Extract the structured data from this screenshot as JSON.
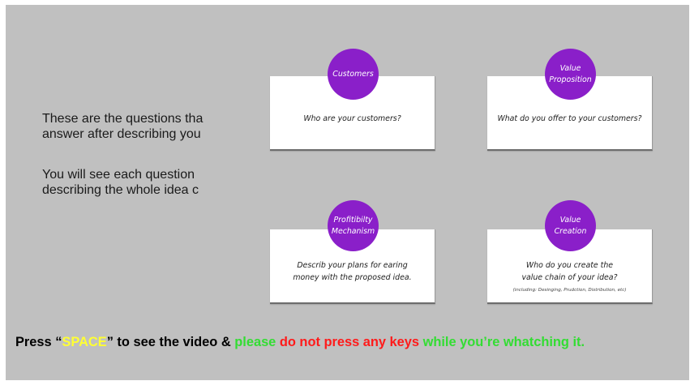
{
  "intro": {
    "paragraph1": [
      "These are the questions tha",
      "answer after describing you"
    ],
    "paragraph2": [
      "You will see each question",
      "describing the whole idea c"
    ]
  },
  "cards": [
    {
      "title_lines": [
        "Customers"
      ],
      "question_lines": [
        "Who are your customers?"
      ],
      "note": ""
    },
    {
      "title_lines": [
        "Value",
        "Proposition"
      ],
      "question_lines": [
        "What do you offer to your customers?"
      ],
      "note": ""
    },
    {
      "title_lines": [
        "Profitibilty",
        "Mechanism"
      ],
      "question_lines": [
        "Describ your plans for earing",
        "money with the proposed idea."
      ],
      "note": ""
    },
    {
      "title_lines": [
        "Value",
        "Creation"
      ],
      "question_lines": [
        "Who do you create the",
        "value chain of your idea?"
      ],
      "note": "(including: Desinging, Prudction, Distribution, etc)"
    }
  ],
  "instruction": {
    "part1": "Press “",
    "key": "SPACE",
    "part2": "” to see the video & ",
    "part3": "please ",
    "part4": "do not press any keys",
    "part5": " while you’re whatching it."
  },
  "colors": {
    "background": "#c0c0c0",
    "badge": "#8a1fc9",
    "key_highlight": "#ffff33",
    "please_green": "#33dd33",
    "warning_red": "#ff1a1a"
  }
}
